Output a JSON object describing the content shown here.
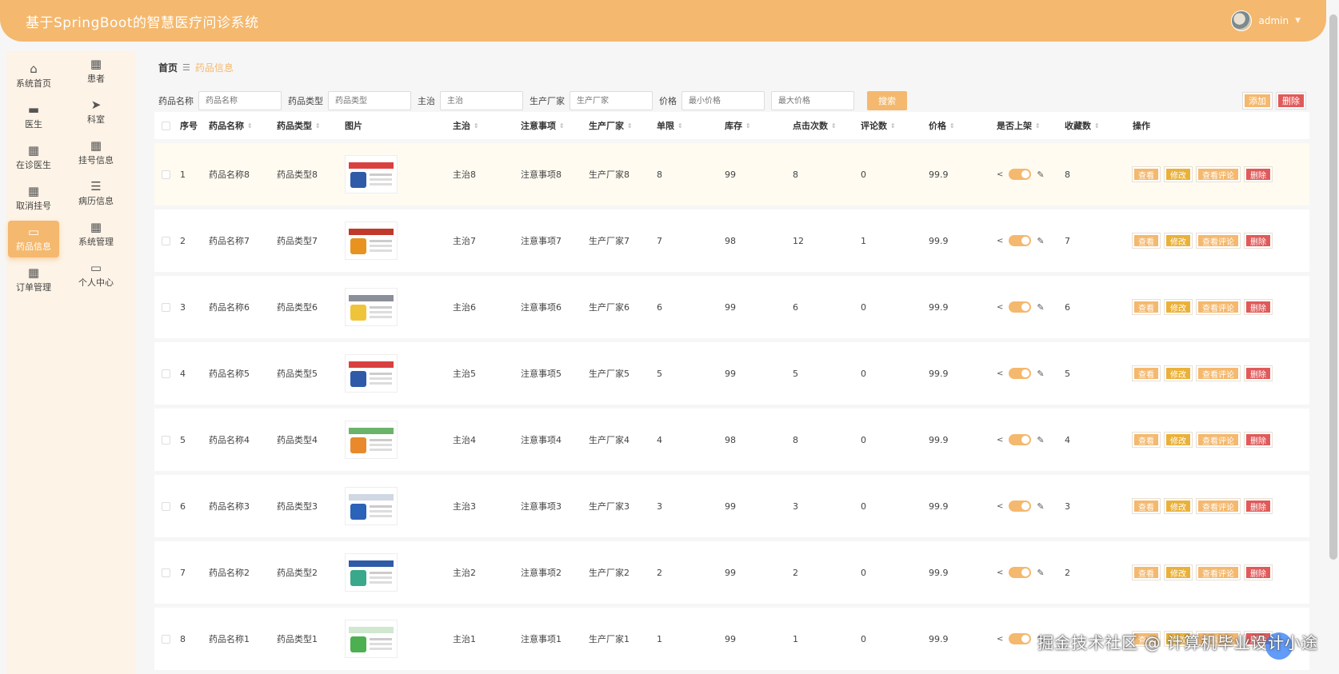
{
  "app": {
    "title": "基于SpringBoot的智慧医疗问诊系统",
    "user": "admin"
  },
  "sidebar": {
    "items": [
      {
        "label": "系统首页",
        "icon": "home-icon"
      },
      {
        "label": "患者",
        "icon": "grid-icon"
      },
      {
        "label": "医生",
        "icon": "chat-icon"
      },
      {
        "label": "科室",
        "icon": "send-icon"
      },
      {
        "label": "在诊医生",
        "icon": "grid-icon"
      },
      {
        "label": "挂号信息",
        "icon": "grid-icon"
      },
      {
        "label": "取消挂号",
        "icon": "grid-icon"
      },
      {
        "label": "病历信息",
        "icon": "list-icon"
      },
      {
        "label": "药品信息",
        "icon": "monitor-icon"
      },
      {
        "label": "系统管理",
        "icon": "grid-icon"
      },
      {
        "label": "订单管理",
        "icon": "apps-icon"
      },
      {
        "label": "个人中心",
        "icon": "card-icon"
      }
    ]
  },
  "breadcrumb": {
    "home": "首页",
    "sep": "☰",
    "current": "药品信息"
  },
  "search": {
    "name_label": "药品名称",
    "name_placeholder": "药品名称",
    "type_label": "药品类型",
    "type_placeholder": "药品类型",
    "main_label": "主治",
    "main_placeholder": "主治",
    "mfr_label": "生产厂家",
    "mfr_placeholder": "生产厂家",
    "price_label": "价格",
    "min_placeholder": "最小价格",
    "max_placeholder": "最大价格",
    "button": "搜索"
  },
  "actions": {
    "add": "添加",
    "delete": "删除"
  },
  "table": {
    "headers": [
      "序号",
      "药品名称",
      "药品类型",
      "图片",
      "主治",
      "注意事项",
      "生产厂家",
      "单限",
      "库存",
      "点击次数",
      "评论数",
      "价格",
      "是否上架",
      "收藏数",
      "操作"
    ],
    "ops": {
      "view": "查看",
      "edit": "修改",
      "comments": "查看评论",
      "delete": "删除"
    },
    "rows": [
      {
        "idx": "1",
        "name": "药品名称8",
        "type": "药品类型8",
        "main": "主治8",
        "note": "注意事项8",
        "mfr": "生产厂家8",
        "limit": "8",
        "stock": "99",
        "clicks": "8",
        "comments": "0",
        "price": "99.9",
        "fav": "8",
        "img": "blue-red"
      },
      {
        "idx": "2",
        "name": "药品名称7",
        "type": "药品类型7",
        "main": "主治7",
        "note": "注意事项7",
        "mfr": "生产厂家7",
        "limit": "7",
        "stock": "98",
        "clicks": "12",
        "comments": "1",
        "price": "99.9",
        "fav": "7",
        "img": "orange-bottle"
      },
      {
        "idx": "3",
        "name": "药品名称6",
        "type": "药品类型6",
        "main": "主治6",
        "note": "注意事项6",
        "mfr": "生产厂家6",
        "limit": "6",
        "stock": "99",
        "clicks": "6",
        "comments": "0",
        "price": "99.9",
        "fav": "6",
        "img": "yellow"
      },
      {
        "idx": "4",
        "name": "药品名称5",
        "type": "药品类型5",
        "main": "主治5",
        "note": "注意事项5",
        "mfr": "生产厂家5",
        "limit": "5",
        "stock": "99",
        "clicks": "5",
        "comments": "0",
        "price": "99.9",
        "fav": "5",
        "img": "blue-red"
      },
      {
        "idx": "5",
        "name": "药品名称4",
        "type": "药品类型4",
        "main": "主治4",
        "note": "注意事项4",
        "mfr": "生产厂家4",
        "limit": "4",
        "stock": "98",
        "clicks": "8",
        "comments": "0",
        "price": "99.9",
        "fav": "4",
        "img": "orange-box"
      },
      {
        "idx": "6",
        "name": "药品名称3",
        "type": "药品类型3",
        "main": "主治3",
        "note": "注意事项3",
        "mfr": "生产厂家3",
        "limit": "3",
        "stock": "99",
        "clicks": "3",
        "comments": "0",
        "price": "99.9",
        "fav": "3",
        "img": "blue-box"
      },
      {
        "idx": "7",
        "name": "药品名称2",
        "type": "药品类型2",
        "main": "主治2",
        "note": "注意事项2",
        "mfr": "生产厂家2",
        "limit": "2",
        "stock": "99",
        "clicks": "2",
        "comments": "0",
        "price": "99.9",
        "fav": "2",
        "img": "green-blue"
      },
      {
        "idx": "8",
        "name": "药品名称1",
        "type": "药品类型1",
        "main": "主治1",
        "note": "注意事项1",
        "mfr": "生产厂家1",
        "limit": "1",
        "stock": "99",
        "clicks": "1",
        "comments": "0",
        "price": "99.9",
        "fav": "",
        "img": "green"
      }
    ]
  },
  "watermark": "掘金技术社区 @ 计算机毕业设计小途",
  "colors": {
    "accent": "#f4b86e",
    "danger": "#e05a5a",
    "edit": "#eab13a"
  }
}
